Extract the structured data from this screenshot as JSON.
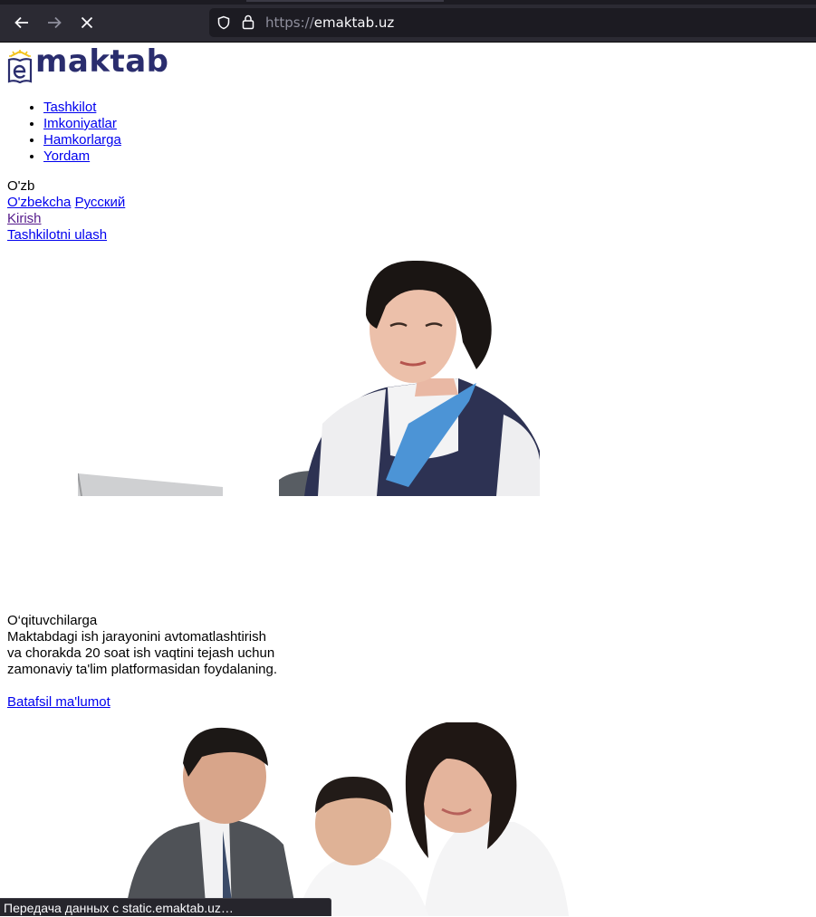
{
  "browser": {
    "url_scheme": "https://",
    "url_host": "emaktab.uz",
    "icons": {
      "back": "arrow-left-icon",
      "forward": "arrow-right-icon",
      "stop": "close-icon",
      "shield": "shield-icon",
      "lock": "lock-icon"
    }
  },
  "logo": {
    "text": "maktab",
    "mark": "e-book-icon"
  },
  "nav": {
    "items": [
      "Tashkilot",
      "Imkoniyatlar",
      "Hamkorlarga",
      "Yordam"
    ]
  },
  "language": {
    "current": "O'zb",
    "option_uz": "O'zbekcha",
    "option_ru": "Русский"
  },
  "auth": {
    "login": "Kirish",
    "register": "Tashkilotni ulash"
  },
  "teachers": {
    "title": "O‘qituvchilarga",
    "line1": "Maktabdagi ish jarayonini avtomatlashtirish",
    "line2": "va chorakda 20 soat ish vaqtini tejash uchun",
    "line3": "zamonaviy ta'lim platformasidan foydalaning.",
    "more_link": "Batafsil ma'lumot"
  },
  "status": {
    "text": "Передача данных с static.emaktab.uz…"
  },
  "colors": {
    "link": "#0000ee",
    "visited": "#551a8b",
    "chrome": "#2b2a33",
    "logo": "#2a2d6e",
    "logo_accent": "#f2c21b"
  }
}
